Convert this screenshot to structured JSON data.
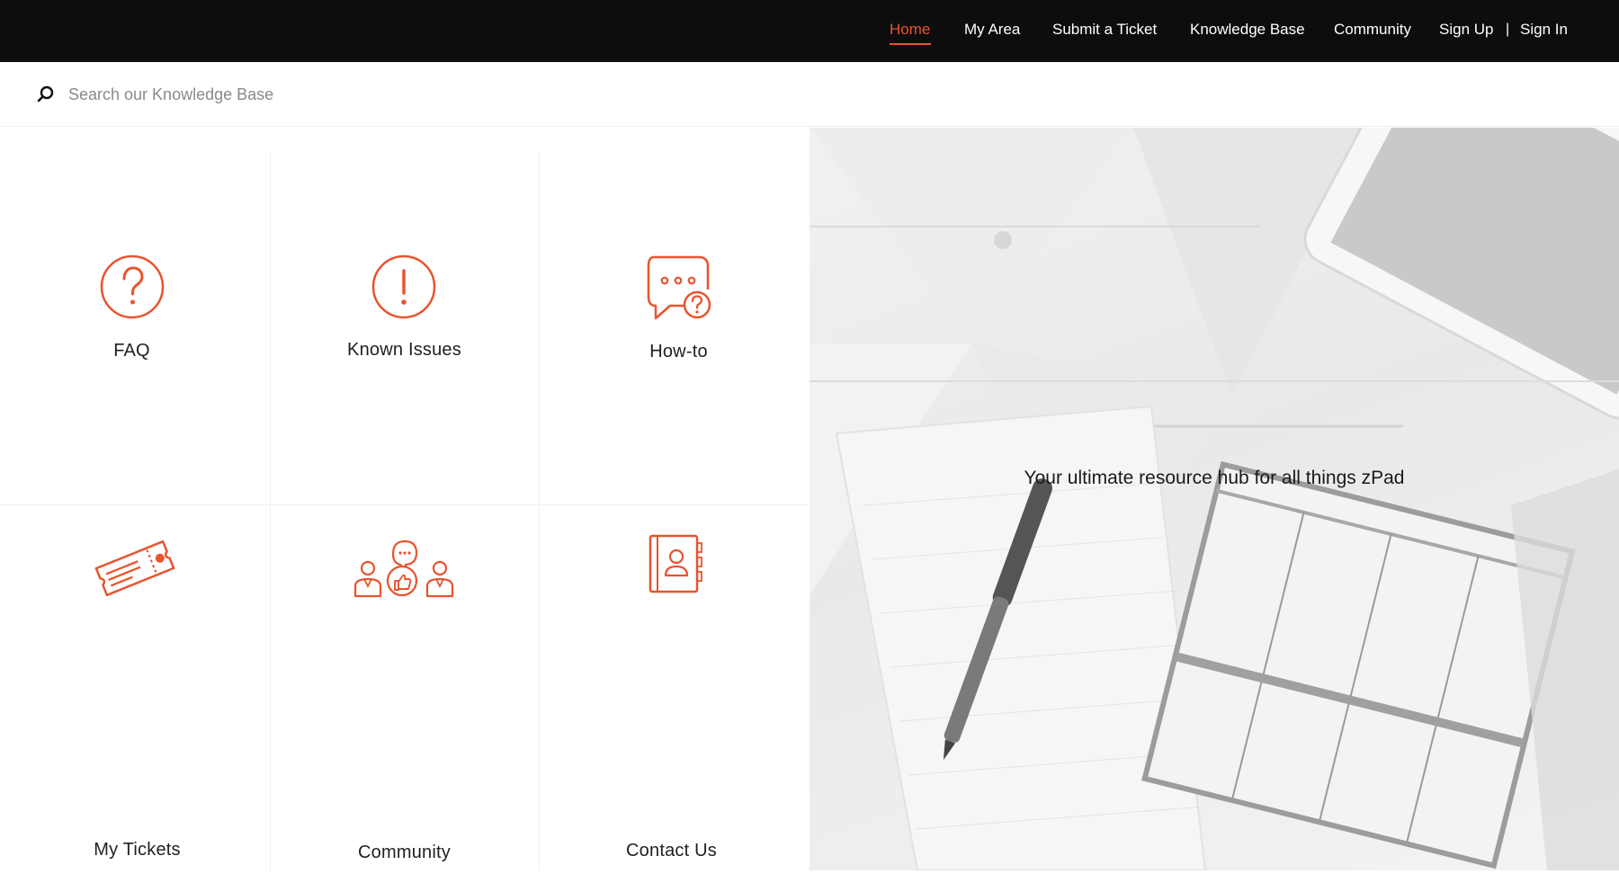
{
  "nav": {
    "items": [
      {
        "label": "Home",
        "active": true
      },
      {
        "label": "My Area"
      },
      {
        "label": "Submit a Ticket"
      },
      {
        "label": "Knowledge Base"
      },
      {
        "label": "Community"
      },
      {
        "label": "Sign Up"
      }
    ],
    "separator": "|",
    "sign_in": "Sign In"
  },
  "search": {
    "placeholder": "Search our Knowledge Base",
    "icon": "search-icon"
  },
  "tiles": [
    {
      "label": "FAQ",
      "icon": "question-circle-icon"
    },
    {
      "label": "Known Issues",
      "icon": "exclamation-circle-icon"
    },
    {
      "label": "How-to",
      "icon": "chat-question-icon"
    },
    {
      "label": "My Tickets",
      "icon": "ticket-icon"
    },
    {
      "label": "Community",
      "icon": "community-group-icon"
    },
    {
      "label": "Contact Us",
      "icon": "address-book-icon"
    }
  ],
  "hero": {
    "tagline": "Your ultimate resource hub for all things zPad"
  },
  "colors": {
    "accent": "#e8542e",
    "topbar": "#0d0d0d"
  }
}
